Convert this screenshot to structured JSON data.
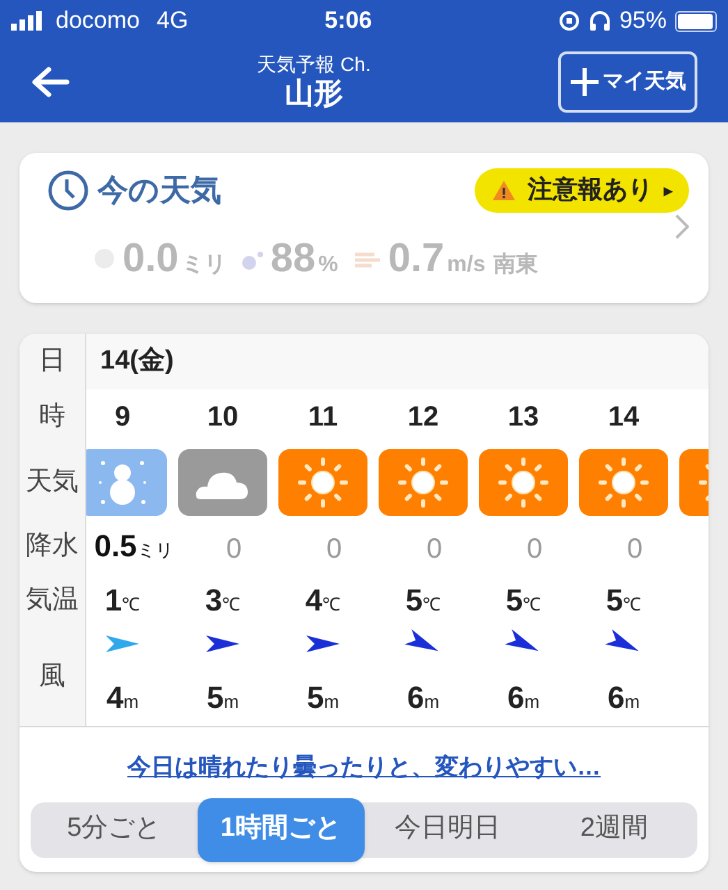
{
  "status_bar": {
    "carrier": "docomo",
    "network": "4G",
    "time": "5:06",
    "battery": "95%"
  },
  "header": {
    "subtitle": "天気予報 Ch.",
    "title": "山形",
    "add_button": "マイ天気"
  },
  "current": {
    "title": "今の天気",
    "alert": "注意報あり",
    "alert_arrow": "▸",
    "stats": [
      {
        "kind": "rain",
        "value": "0.0",
        "unit": "ミリ"
      },
      {
        "kind": "humidity",
        "value": "88",
        "unit": "%"
      },
      {
        "kind": "wind",
        "value": "0.7",
        "unit": "m/s",
        "extra": "南東"
      }
    ]
  },
  "hourly": {
    "labels": {
      "date": "日",
      "hour": "時",
      "weather": "天気",
      "precip": "降水",
      "temp": "気温",
      "wind": "風"
    },
    "date": "14(金)",
    "hours": [
      {
        "hour": "9",
        "weather": {
          "kind": "snow"
        },
        "precip": "0.5",
        "precip_unit": "ミリ",
        "precip_zero": false,
        "temp": "1",
        "temp_unit": "℃",
        "wind_arrow": {
          "kind": "east",
          "color": "#2fa8ec"
        },
        "wind": "4",
        "wind_unit": "m"
      },
      {
        "hour": "10",
        "weather": {
          "kind": "cloud"
        },
        "precip": "0",
        "precip_zero": true,
        "temp": "3",
        "temp_unit": "℃",
        "wind_arrow": {
          "kind": "east",
          "color": "#1b2fd8"
        },
        "wind": "5",
        "wind_unit": "m"
      },
      {
        "hour": "11",
        "weather": {
          "kind": "sun"
        },
        "precip": "0",
        "precip_zero": true,
        "temp": "4",
        "temp_unit": "℃",
        "wind_arrow": {
          "kind": "east",
          "color": "#1b2fd8"
        },
        "wind": "5",
        "wind_unit": "m"
      },
      {
        "hour": "12",
        "weather": {
          "kind": "sun"
        },
        "precip": "0",
        "precip_zero": true,
        "temp": "5",
        "temp_unit": "℃",
        "wind_arrow": {
          "kind": "southeast",
          "color": "#1b2fd8"
        },
        "wind": "6",
        "wind_unit": "m"
      },
      {
        "hour": "13",
        "weather": {
          "kind": "sun"
        },
        "precip": "0",
        "precip_zero": true,
        "temp": "5",
        "temp_unit": "℃",
        "wind_arrow": {
          "kind": "southeast",
          "color": "#1b2fd8"
        },
        "wind": "6",
        "wind_unit": "m"
      },
      {
        "hour": "14",
        "weather": {
          "kind": "sun"
        },
        "precip": "0",
        "precip_zero": true,
        "temp": "5",
        "temp_unit": "℃",
        "wind_arrow": {
          "kind": "southeast",
          "color": "#1b2fd8"
        },
        "wind": "6",
        "wind_unit": "m"
      },
      {
        "weather": {
          "kind": "sun"
        }
      }
    ]
  },
  "summary_link": "今日は晴れたり曇ったりと、変わりやすい…",
  "tabs": [
    {
      "label": "5分ごと",
      "selected": false
    },
    {
      "label": "1時間ごと",
      "selected": true
    },
    {
      "label": "今日明日",
      "selected": false
    },
    {
      "label": "2週間",
      "selected": false
    }
  ]
}
